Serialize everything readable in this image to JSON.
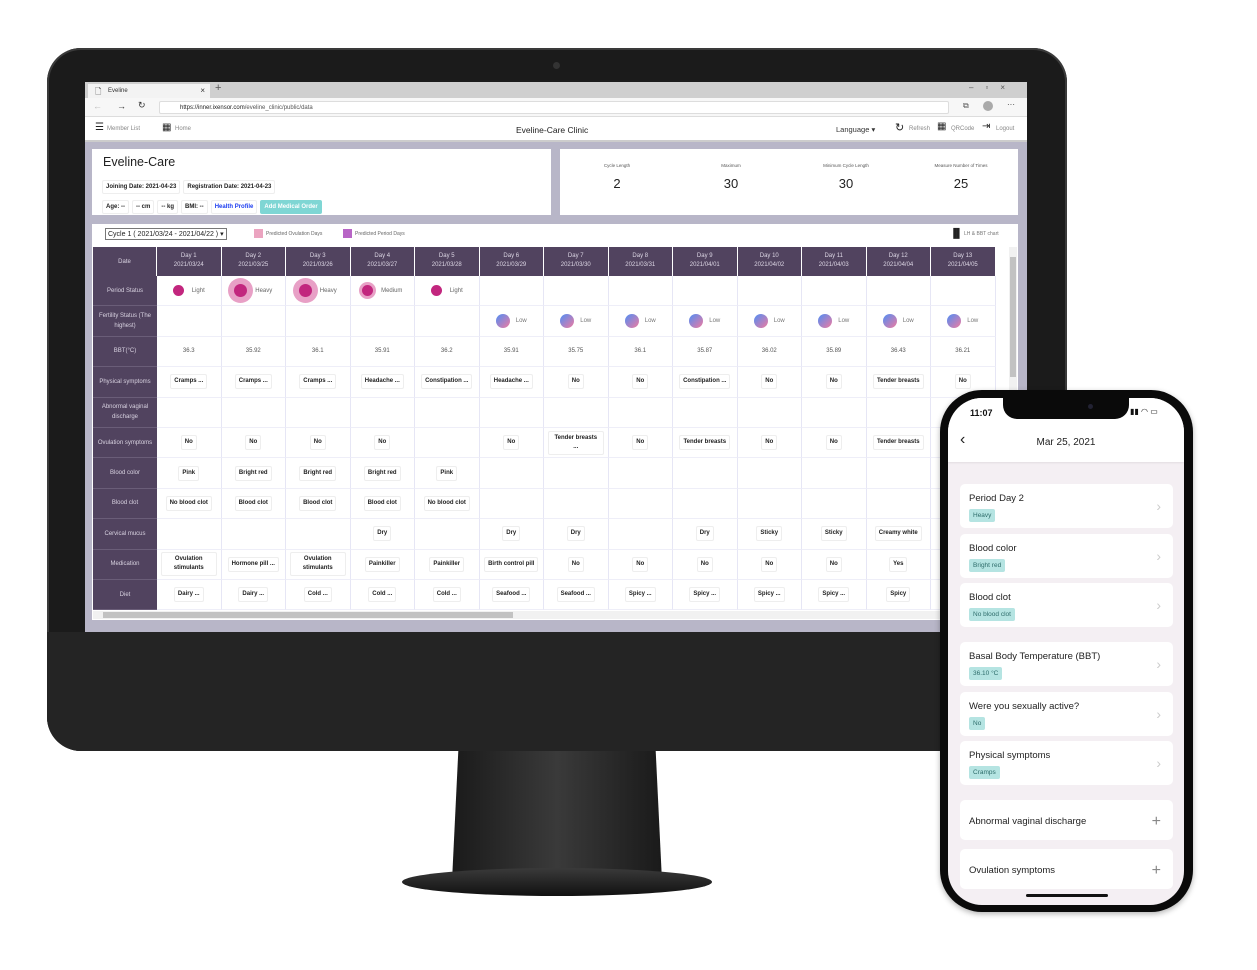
{
  "browser": {
    "tab_title": "Eveline",
    "url_host": "https://inner.ixensor.com",
    "url_path": "/eveline_clinic/public/data"
  },
  "nav": {
    "member_list": "Member List",
    "home": "Home",
    "title": "Eveline-Care Clinic",
    "language": "Language",
    "refresh": "Refresh",
    "qrcode": "QRCode",
    "logout": "Logout"
  },
  "profile": {
    "name": "Eveline-Care",
    "joining": "Joining Date: 2021-04-23",
    "registration": "Registration Date: 2021-04-23",
    "age": "Age: --",
    "height": "-- cm",
    "weight": "-- kg",
    "bmi": "BMI: --",
    "health_profile": "Health Profile",
    "add_order": "Add Medical Order"
  },
  "stats": [
    {
      "label": "Cycle Length",
      "value": "2"
    },
    {
      "label": "Maximum",
      "value": "30"
    },
    {
      "label": "Minimum Cycle Length",
      "value": "30"
    },
    {
      "label": "Measure Number of Times",
      "value": "25"
    }
  ],
  "toolbar": {
    "cycle": "Cycle 1 ( 2021/03/24 - 2021/04/22 )",
    "legend_ovulation": "Predicted Ovulation Days",
    "legend_period": "Predicted Period Days",
    "chart_link": "LH & BBT chart",
    "colors": {
      "ovulation": "#eba4c0",
      "period": "#b865c6",
      "header": "#51435f"
    }
  },
  "table": {
    "date_label": "Date",
    "days": [
      {
        "d": "Day 1",
        "date": "2021/03/24"
      },
      {
        "d": "Day 2",
        "date": "2021/03/25"
      },
      {
        "d": "Day 3",
        "date": "2021/03/26"
      },
      {
        "d": "Day 4",
        "date": "2021/03/27"
      },
      {
        "d": "Day 5",
        "date": "2021/03/28"
      },
      {
        "d": "Day 6",
        "date": "2021/03/29"
      },
      {
        "d": "Day 7",
        "date": "2021/03/30"
      },
      {
        "d": "Day 8",
        "date": "2021/03/31"
      },
      {
        "d": "Day 9",
        "date": "2021/04/01"
      },
      {
        "d": "Day 10",
        "date": "2021/04/02"
      },
      {
        "d": "Day 11",
        "date": "2021/04/03"
      },
      {
        "d": "Day 12",
        "date": "2021/04/04"
      },
      {
        "d": "Day 13",
        "date": "2021/04/05"
      }
    ],
    "rows": [
      {
        "label": "Period Status",
        "kind": "period",
        "cells": [
          "Light",
          "Heavy",
          "Heavy",
          "Medium",
          "Light",
          "",
          "",
          "",
          "",
          "",
          "",
          "",
          ""
        ]
      },
      {
        "label": "Fertility Status (The highest)",
        "kind": "fert",
        "cells": [
          "",
          "",
          "",
          "",
          "",
          "Low",
          "Low",
          "Low",
          "Low",
          "Low",
          "Low",
          "Low",
          "Low"
        ]
      },
      {
        "label": "BBT(°C)",
        "kind": "text",
        "cells": [
          "36.3",
          "35.92",
          "36.1",
          "35.91",
          "36.2",
          "35.91",
          "35.75",
          "36.1",
          "35.87",
          "36.02",
          "35.89",
          "36.43",
          "36.21"
        ]
      },
      {
        "label": "Physical symptoms",
        "kind": "badge",
        "cells": [
          "Cramps ...",
          "Cramps ...",
          "Cramps ...",
          "Headache ...",
          "Constipation ...",
          "Headache ...",
          "No",
          "No",
          "Constipation ...",
          "No",
          "No",
          "Tender breasts",
          "No"
        ]
      },
      {
        "label": "Abnormal vaginal discharge",
        "kind": "badge",
        "cells": [
          "",
          "",
          "",
          "",
          "",
          "",
          "",
          "",
          "",
          "",
          "",
          "",
          ""
        ]
      },
      {
        "label": "Ovulation symptoms",
        "kind": "badge",
        "cells": [
          "No",
          "No",
          "No",
          "No",
          "",
          "No",
          "Tender breasts ...",
          "No",
          "Tender breasts",
          "No",
          "No",
          "Tender breasts",
          ""
        ]
      },
      {
        "label": "Blood color",
        "kind": "badge",
        "cells": [
          "Pink",
          "Bright red",
          "Bright red",
          "Bright red",
          "Pink",
          "",
          "",
          "",
          "",
          "",
          "",
          "",
          ""
        ]
      },
      {
        "label": "Blood clot",
        "kind": "badge",
        "cells": [
          "No blood clot",
          "Blood clot",
          "Blood clot",
          "Blood clot",
          "No blood clot",
          "",
          "",
          "",
          "",
          "",
          "",
          "",
          ""
        ]
      },
      {
        "label": "Cervical mucus",
        "kind": "badge",
        "cells": [
          "",
          "",
          "",
          "Dry",
          "",
          "Dry",
          "Dry",
          "",
          "Dry",
          "Sticky",
          "Sticky",
          "Creamy white",
          ""
        ]
      },
      {
        "label": "Medication",
        "kind": "badge",
        "cells": [
          "Ovulation stimulants",
          "Hormone pill ...",
          "Ovulation stimulants",
          "Painkiller",
          "Painkiller",
          "Birth control pill",
          "No",
          "No",
          "No",
          "No",
          "No",
          "Yes",
          ""
        ]
      },
      {
        "label": "Diet",
        "kind": "badge",
        "cells": [
          "Dairy ...",
          "Dairy ...",
          "Cold ...",
          "Cold ...",
          "Cold ...",
          "Seafood ...",
          "Seafood ...",
          "Spicy ...",
          "Spicy ...",
          "Spicy ...",
          "Spicy ...",
          "Spicy",
          ""
        ]
      }
    ]
  },
  "phone": {
    "time": "11:07",
    "date": "Mar 25, 2021",
    "items": [
      {
        "title": "Period Day 2",
        "tag": "Heavy",
        "action": "chevron"
      },
      {
        "title": "Blood color",
        "tag": "Bright red",
        "action": "chevron"
      },
      {
        "title": "Blood clot",
        "tag": "No blood clot",
        "action": "chevron"
      },
      {
        "title": "Basal Body Temperature (BBT)",
        "tag": "36.10 °C",
        "action": "chevron"
      },
      {
        "title": "Were you sexually active?",
        "tag": "No",
        "action": "chevron"
      },
      {
        "title": "Physical symptoms",
        "tag": "Cramps",
        "action": "chevron"
      },
      {
        "title": "Abnormal vaginal discharge",
        "tag": "",
        "action": "plus"
      },
      {
        "title": "Ovulation symptoms",
        "tag": "",
        "action": "plus"
      }
    ]
  }
}
